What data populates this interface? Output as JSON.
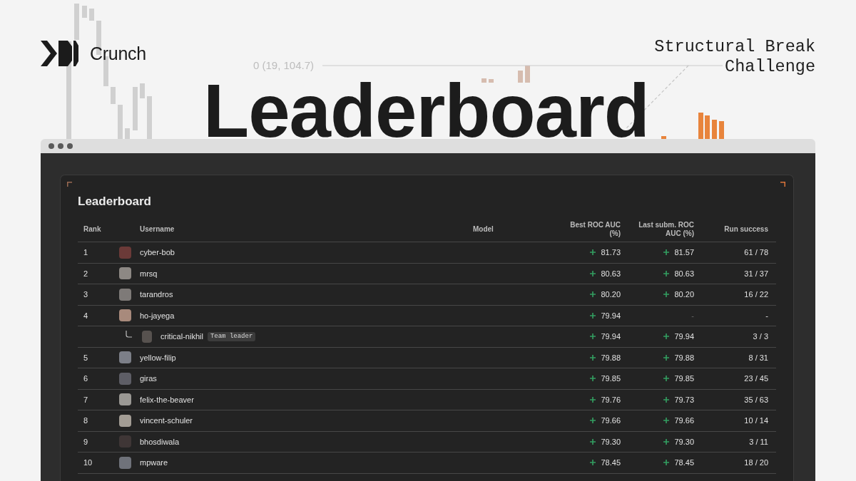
{
  "brand": {
    "name": "Crunch"
  },
  "hero": {
    "chart_label": "0 (19, 104.7)",
    "title": "Leaderboard",
    "subtitle": "Structural Break Challenge"
  },
  "leaderboard": {
    "title": "Leaderboard",
    "columns": [
      "Rank",
      "Username",
      "Model",
      "Best ROC AUC (%)",
      "Last subm. ROC AUC (%)",
      "Run success"
    ],
    "rows": [
      {
        "rank": "1",
        "username": "cyber-bob",
        "best": {
          "value": "81.73",
          "kind": "improved"
        },
        "last": {
          "value": "81.57",
          "kind": "improved"
        },
        "run_success": "61 / 78"
      },
      {
        "rank": "2",
        "username": "mrsq",
        "best": {
          "value": "80.63",
          "kind": "improved"
        },
        "last": {
          "value": "80.63",
          "kind": "improved"
        },
        "run_success": "31 / 37"
      },
      {
        "rank": "3",
        "username": "tarandros",
        "best": {
          "value": "80.20",
          "kind": "improved"
        },
        "last": {
          "value": "80.20",
          "kind": "improved"
        },
        "run_success": "16 / 22"
      },
      {
        "rank": "4",
        "username": "ho-jayega",
        "best": {
          "value": "79.94",
          "kind": "improved"
        },
        "last": {
          "value": "-",
          "kind": "missing"
        },
        "run_success": "-",
        "children": [
          {
            "username": "critical-nikhil",
            "badge": "Team leader",
            "best": {
              "value": "79.94",
              "kind": "improved"
            },
            "last": {
              "value": "79.94",
              "kind": "improved"
            },
            "run_success": "3 / 3"
          }
        ]
      },
      {
        "rank": "5",
        "username": "yellow-filip",
        "best": {
          "value": "79.88",
          "kind": "improved"
        },
        "last": {
          "value": "79.88",
          "kind": "improved"
        },
        "run_success": "8 / 31"
      },
      {
        "rank": "6",
        "username": "giras",
        "best": {
          "value": "79.85",
          "kind": "improved"
        },
        "last": {
          "value": "79.85",
          "kind": "improved"
        },
        "run_success": "23 / 45"
      },
      {
        "rank": "7",
        "username": "felix-the-beaver",
        "best": {
          "value": "79.76",
          "kind": "improved"
        },
        "last": {
          "value": "79.73",
          "kind": "improved"
        },
        "run_success": "35 / 63"
      },
      {
        "rank": "8",
        "username": "vincent-schuler",
        "best": {
          "value": "79.66",
          "kind": "improved"
        },
        "last": {
          "value": "79.66",
          "kind": "improved"
        },
        "run_success": "10 / 14"
      },
      {
        "rank": "9",
        "username": "bhosdiwala",
        "best": {
          "value": "79.30",
          "kind": "improved"
        },
        "last": {
          "value": "79.30",
          "kind": "improved"
        },
        "run_success": "3 / 11"
      },
      {
        "rank": "10",
        "username": "mpware",
        "best": {
          "value": "78.45",
          "kind": "improved"
        },
        "last": {
          "value": "78.45",
          "kind": "improved"
        },
        "run_success": "18 / 20"
      }
    ]
  }
}
